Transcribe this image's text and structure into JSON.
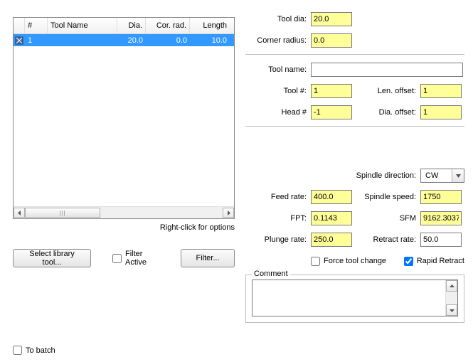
{
  "table": {
    "headers": [
      "#",
      "Tool Name",
      "Dia.",
      "Cor. rad.",
      "Length"
    ],
    "row": {
      "num": "1",
      "name": "",
      "dia": "20.0",
      "crad": "0.0",
      "len": "10.0"
    },
    "hint": "Right-click for options"
  },
  "buttons": {
    "select_library": "Select library tool...",
    "filter": "Filter..."
  },
  "checks": {
    "filter_active": "Filter Active",
    "force_change": "Force tool change",
    "rapid_retract": "Rapid Retract",
    "to_batch": "To batch"
  },
  "labels": {
    "tool_dia": "Tool dia:",
    "corner_radius": "Corner radius:",
    "tool_name": "Tool name:",
    "tool_num": "Tool #:",
    "len_offset": "Len. offset:",
    "head_num": "Head #",
    "dia_offset": "Dia. offset:",
    "spindle_dir": "Spindle direction:",
    "feed_rate": "Feed rate:",
    "spindle_speed": "Spindle speed:",
    "fpt": "FPT:",
    "sfm": "SFM",
    "plunge_rate": "Plunge rate:",
    "retract_rate": "Retract rate:",
    "comment": "Comment"
  },
  "values": {
    "tool_dia": "20.0",
    "corner_radius": "0.0",
    "tool_name": "",
    "tool_num": "1",
    "len_offset": "1",
    "head_num": "-1",
    "dia_offset": "1",
    "spindle_dir": "CW",
    "feed_rate": "400.0",
    "spindle_speed": "1750",
    "fpt": "0.1143",
    "sfm": "9162.3037",
    "plunge_rate": "250.0",
    "retract_rate": "50.0",
    "comment": ""
  },
  "flags": {
    "filter_active": false,
    "force_change": false,
    "rapid_retract": true,
    "to_batch": false
  }
}
